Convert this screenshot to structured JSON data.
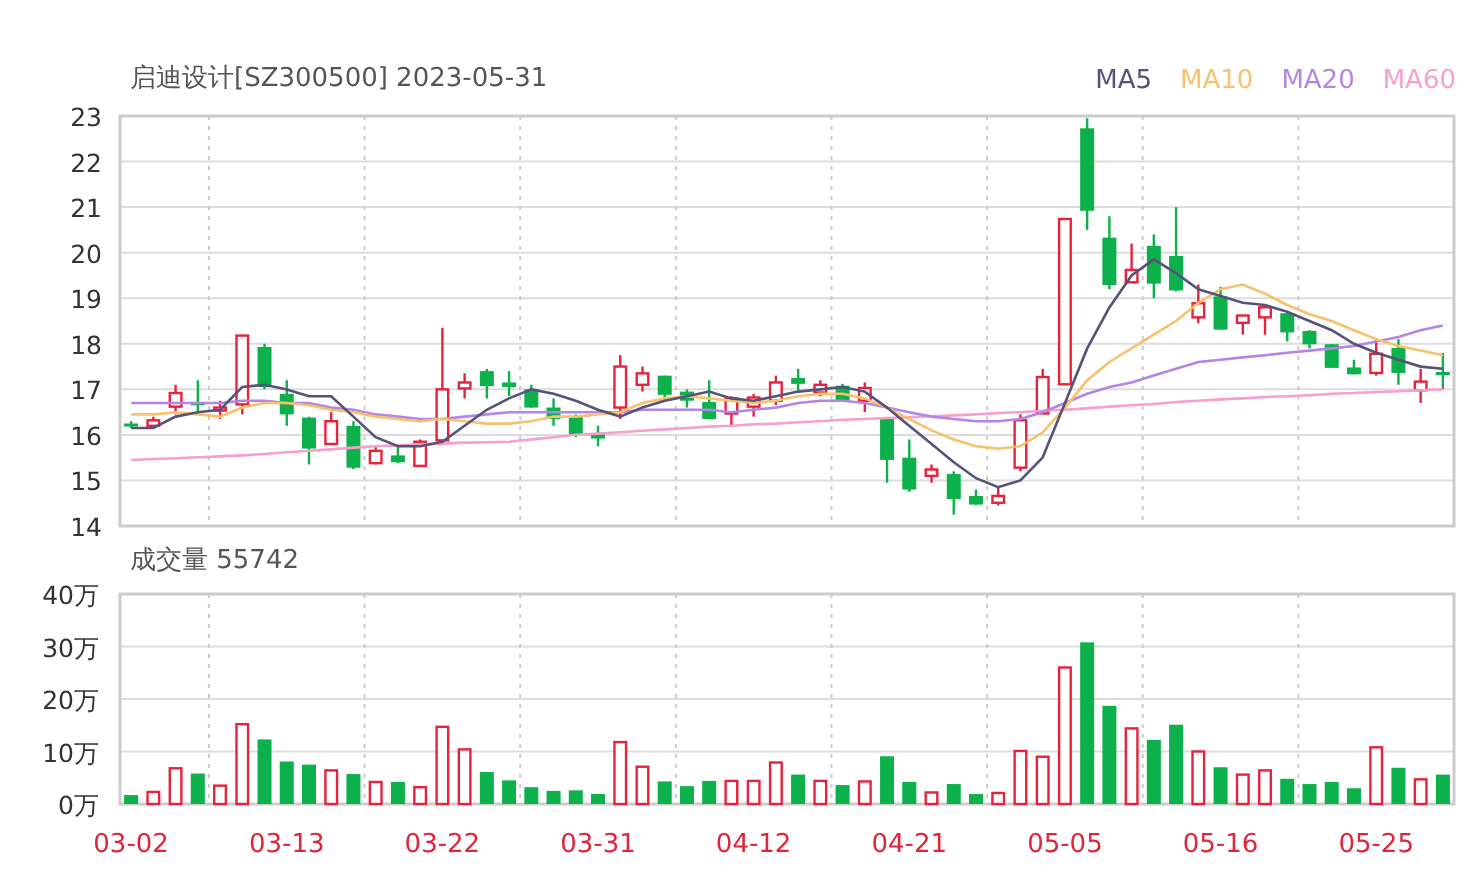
{
  "header": {
    "title": "启迪设计[SZ300500] 2023-05-31"
  },
  "price_chart": {
    "chart_data": {
      "type": "candlestick",
      "grid": true,
      "ylim": [
        14,
        23
      ],
      "ohlc": [
        [
          16.25,
          16.3,
          16.15,
          16.22
        ],
        [
          16.2,
          16.4,
          16.15,
          16.32
        ],
        [
          16.62,
          17.1,
          16.45,
          16.92
        ],
        [
          16.72,
          17.2,
          16.45,
          16.65
        ],
        [
          16.55,
          16.75,
          16.35,
          16.6
        ],
        [
          16.67,
          18.2,
          16.45,
          18.18
        ],
        [
          17.93,
          18.0,
          17.0,
          17.05
        ],
        [
          16.9,
          17.2,
          16.2,
          16.45
        ],
        [
          16.38,
          16.4,
          15.35,
          15.7
        ],
        [
          15.8,
          16.5,
          15.8,
          16.3
        ],
        [
          16.2,
          16.3,
          15.25,
          15.28
        ],
        [
          15.38,
          15.75,
          15.35,
          15.65
        ],
        [
          15.55,
          15.8,
          15.38,
          15.4
        ],
        [
          15.32,
          15.9,
          15.3,
          15.85
        ],
        [
          15.88,
          18.35,
          15.85,
          17.0
        ],
        [
          17.02,
          17.35,
          16.8,
          17.15
        ],
        [
          17.4,
          17.45,
          16.8,
          17.07
        ],
        [
          17.15,
          17.4,
          16.85,
          17.05
        ],
        [
          17.0,
          17.1,
          16.6,
          16.6
        ],
        [
          16.6,
          16.8,
          16.2,
          16.35
        ],
        [
          16.4,
          16.45,
          15.95,
          16.0
        ],
        [
          16.02,
          16.2,
          15.75,
          15.92
        ],
        [
          16.6,
          17.75,
          16.35,
          17.5
        ],
        [
          17.1,
          17.5,
          16.95,
          17.35
        ],
        [
          17.3,
          17.3,
          16.75,
          16.88
        ],
        [
          16.95,
          17.0,
          16.6,
          16.75
        ],
        [
          16.72,
          17.2,
          16.35,
          16.35
        ],
        [
          16.47,
          16.85,
          16.2,
          16.8
        ],
        [
          16.62,
          16.9,
          16.4,
          16.82
        ],
        [
          16.75,
          17.3,
          16.65,
          17.15
        ],
        [
          17.25,
          17.45,
          16.95,
          17.12
        ],
        [
          16.93,
          17.2,
          16.85,
          17.1
        ],
        [
          17.08,
          17.12,
          16.75,
          16.75
        ],
        [
          16.75,
          17.15,
          16.5,
          17.03
        ],
        [
          16.35,
          16.35,
          14.95,
          15.45
        ],
        [
          15.5,
          15.9,
          14.75,
          14.8
        ],
        [
          15.1,
          15.35,
          14.95,
          15.24
        ],
        [
          15.14,
          15.2,
          14.25,
          14.59
        ],
        [
          14.66,
          14.8,
          14.47,
          14.47
        ],
        [
          14.51,
          14.85,
          14.45,
          14.66
        ],
        [
          15.28,
          16.45,
          15.2,
          16.32
        ],
        [
          16.47,
          17.45,
          16.47,
          17.27
        ],
        [
          17.11,
          20.74,
          17.1,
          20.74
        ],
        [
          22.73,
          22.95,
          20.5,
          20.92
        ],
        [
          20.33,
          20.8,
          19.2,
          19.29
        ],
        [
          19.35,
          20.2,
          19.35,
          19.62
        ],
        [
          20.15,
          20.4,
          19.0,
          19.32
        ],
        [
          19.93,
          21.0,
          19.15,
          19.17
        ],
        [
          18.58,
          19.3,
          18.45,
          18.89
        ],
        [
          19.04,
          19.25,
          18.31,
          18.31
        ],
        [
          18.46,
          18.62,
          18.2,
          18.62
        ],
        [
          18.58,
          18.85,
          18.2,
          18.8
        ],
        [
          18.67,
          18.72,
          18.05,
          18.25
        ],
        [
          18.28,
          18.3,
          17.9,
          17.99
        ],
        [
          17.99,
          17.99,
          17.47,
          17.47
        ],
        [
          17.48,
          17.65,
          17.33,
          17.33
        ],
        [
          17.36,
          18.1,
          17.3,
          17.78
        ],
        [
          17.91,
          18.1,
          17.1,
          17.36
        ],
        [
          16.98,
          17.45,
          16.7,
          17.17
        ],
        [
          17.38,
          17.8,
          17.0,
          17.35
        ]
      ]
    }
  },
  "moving_averages": {
    "chart_data": {
      "type": "line",
      "ylim": [
        14,
        23
      ],
      "yticks": [
        14,
        15,
        16,
        17,
        18,
        19,
        20,
        21,
        22,
        23
      ],
      "series": [
        {
          "name": "MA5",
          "color": "#56537a",
          "values": [
            16.15,
            16.15,
            16.4,
            16.5,
            16.55,
            17.05,
            17.1,
            17.0,
            16.85,
            16.85,
            16.4,
            15.95,
            15.75,
            15.75,
            15.85,
            16.2,
            16.55,
            16.8,
            17.0,
            16.9,
            16.75,
            16.55,
            16.4,
            16.6,
            16.75,
            16.85,
            16.95,
            16.8,
            16.75,
            16.85,
            16.95,
            17.0,
            17.05,
            16.95,
            16.6,
            16.2,
            15.8,
            15.4,
            15.05,
            14.85,
            15.0,
            15.5,
            16.7,
            17.9,
            18.8,
            19.5,
            19.85,
            19.55,
            19.2,
            19.05,
            18.9,
            18.85,
            18.7,
            18.5,
            18.3,
            18.0,
            17.8,
            17.65,
            17.5,
            17.45
          ]
        },
        {
          "name": "MA10",
          "color": "#f7c26b",
          "values": [
            16.45,
            16.45,
            16.5,
            16.45,
            16.4,
            16.6,
            16.7,
            16.7,
            16.65,
            16.55,
            16.5,
            16.4,
            16.35,
            16.3,
            16.35,
            16.3,
            16.25,
            16.25,
            16.3,
            16.4,
            16.4,
            16.45,
            16.5,
            16.7,
            16.8,
            16.85,
            16.8,
            16.75,
            16.7,
            16.75,
            16.85,
            16.9,
            16.9,
            16.8,
            16.6,
            16.35,
            16.1,
            15.9,
            15.75,
            15.7,
            15.75,
            16.05,
            16.6,
            17.2,
            17.6,
            17.9,
            18.2,
            18.5,
            18.9,
            19.2,
            19.3,
            19.1,
            18.85,
            18.65,
            18.5,
            18.3,
            18.1,
            17.95,
            17.85,
            17.75
          ]
        },
        {
          "name": "MA20",
          "color": "#b485e6",
          "values": [
            16.7,
            16.7,
            16.7,
            16.7,
            16.7,
            16.75,
            16.75,
            16.7,
            16.7,
            16.6,
            16.55,
            16.45,
            16.4,
            16.35,
            16.35,
            16.4,
            16.45,
            16.5,
            16.5,
            16.5,
            16.5,
            16.5,
            16.5,
            16.55,
            16.55,
            16.55,
            16.55,
            16.5,
            16.55,
            16.6,
            16.7,
            16.75,
            16.75,
            16.7,
            16.6,
            16.5,
            16.4,
            16.35,
            16.3,
            16.3,
            16.35,
            16.5,
            16.7,
            16.9,
            17.05,
            17.15,
            17.3,
            17.45,
            17.6,
            17.65,
            17.7,
            17.75,
            17.8,
            17.85,
            17.9,
            17.95,
            18.05,
            18.15,
            18.3,
            18.4
          ]
        },
        {
          "name": "MA60",
          "color": "#f6a0cb",
          "values": [
            15.45,
            15.47,
            15.49,
            15.51,
            15.53,
            15.55,
            15.58,
            15.62,
            15.65,
            15.68,
            15.72,
            15.75,
            15.77,
            15.79,
            15.81,
            15.83,
            15.84,
            15.85,
            15.9,
            15.95,
            16.0,
            16.03,
            16.06,
            16.09,
            16.12,
            16.15,
            16.18,
            16.2,
            16.23,
            16.25,
            16.28,
            16.3,
            16.33,
            16.35,
            16.37,
            16.39,
            16.41,
            16.43,
            16.45,
            16.48,
            16.5,
            16.53,
            16.55,
            16.58,
            16.62,
            16.65,
            16.68,
            16.72,
            16.75,
            16.78,
            16.8,
            16.83,
            16.85,
            16.87,
            16.9,
            16.92,
            16.94,
            16.96,
            16.98,
            17.0
          ]
        }
      ]
    }
  },
  "volume_chart": {
    "title": "成交量 55742",
    "chart_data": {
      "type": "bar",
      "grid": true,
      "ylim": [
        0,
        40
      ],
      "yticks": [
        {
          "value": 0,
          "label": "0万"
        },
        {
          "value": 10,
          "label": "10万"
        },
        {
          "value": 20,
          "label": "20万"
        },
        {
          "value": 30,
          "label": "30万"
        },
        {
          "value": 40,
          "label": "40万"
        }
      ],
      "categories": [
        "03-02",
        null,
        null,
        null,
        null,
        null,
        null,
        "03-13",
        null,
        null,
        null,
        null,
        null,
        null,
        "03-22",
        null,
        null,
        null,
        null,
        null,
        null,
        "03-31",
        null,
        null,
        null,
        null,
        null,
        null,
        "04-12",
        null,
        null,
        null,
        null,
        null,
        null,
        "04-21",
        null,
        null,
        null,
        null,
        null,
        null,
        "05-05",
        null,
        null,
        null,
        null,
        null,
        null,
        "05-16",
        null,
        null,
        null,
        null,
        null,
        null,
        "05-25",
        null,
        null,
        null
      ],
      "values": [
        1.7,
        2.3,
        6.8,
        5.8,
        3.5,
        15.2,
        12.3,
        8.1,
        7.5,
        6.4,
        5.7,
        4.2,
        4.2,
        3.2,
        14.7,
        10.4,
        6.1,
        4.5,
        3.2,
        2.5,
        2.6,
        1.9,
        11.8,
        7.1,
        4.3,
        3.4,
        4.4,
        4.4,
        4.4,
        7.9,
        5.6,
        4.4,
        3.6,
        4.3,
        9.1,
        4.2,
        2.2,
        3.8,
        1.9,
        2.1,
        10.1,
        9.0,
        26.0,
        30.8,
        18.7,
        14.4,
        12.2,
        15.1,
        10.0,
        7.0,
        5.6,
        6.4,
        4.8,
        3.8,
        4.2,
        3.0,
        10.8,
        6.9,
        4.7,
        5.6
      ]
    }
  }
}
